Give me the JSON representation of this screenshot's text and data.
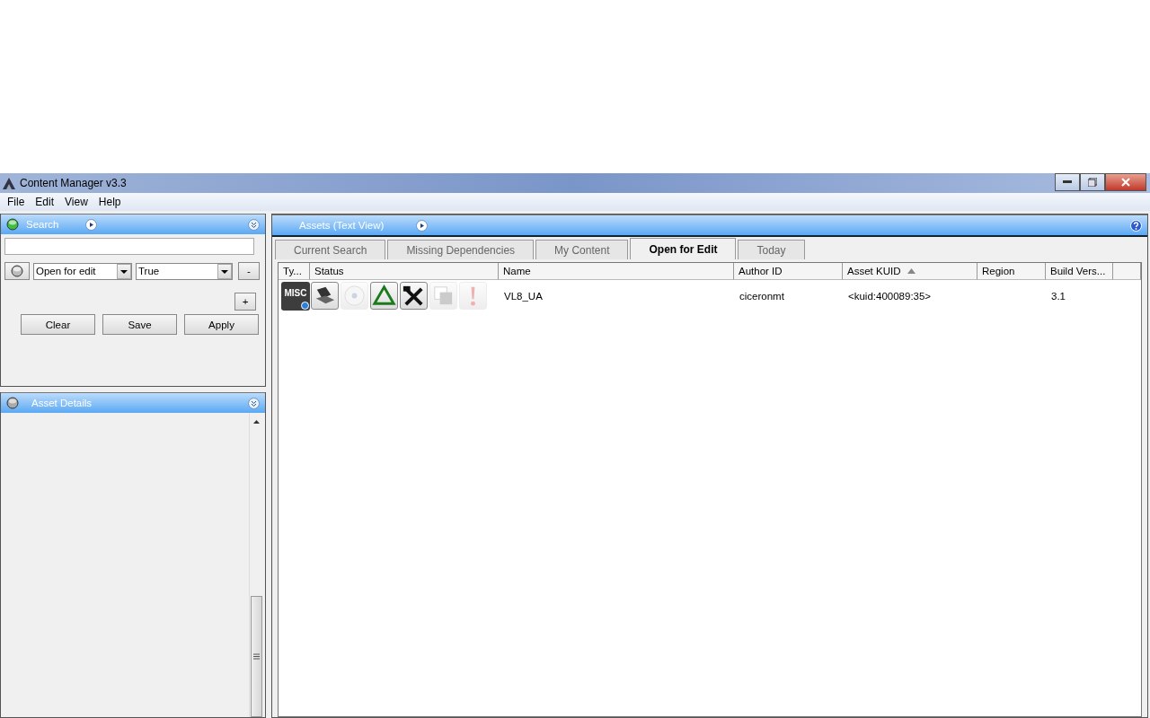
{
  "window": {
    "title": "Content Manager v3.3"
  },
  "menu": [
    "File",
    "Edit",
    "View",
    "Help"
  ],
  "search_panel": {
    "title": "Search",
    "filter": {
      "field": "Open for edit",
      "value": "True"
    },
    "remove_button": "-",
    "add_button": "+",
    "buttons": [
      "Clear",
      "Save",
      "Apply"
    ]
  },
  "details_panel": {
    "title": "Asset Details"
  },
  "assets_panel": {
    "title": "Assets (Text View)",
    "tabs": [
      {
        "label": "Current Search",
        "selected": false
      },
      {
        "label": "Missing Dependencies",
        "selected": false
      },
      {
        "label": "My Content",
        "selected": false
      },
      {
        "label": "Open for Edit",
        "selected": true
      },
      {
        "label": "Today",
        "selected": false
      }
    ],
    "columns": [
      {
        "label": "Ty...",
        "sorted": false
      },
      {
        "label": "Status",
        "sorted": false
      },
      {
        "label": "Name",
        "sorted": false
      },
      {
        "label": "Author ID",
        "sorted": false
      },
      {
        "label": "Asset KUID",
        "sorted": true
      },
      {
        "label": "Region",
        "sorted": false
      },
      {
        "label": "Build Vers...",
        "sorted": false
      }
    ],
    "rows": [
      {
        "type": "MISC",
        "status": [
          {
            "kind": "laptop",
            "enabled": true
          },
          {
            "kind": "disc",
            "enabled": false
          },
          {
            "kind": "triangle",
            "enabled": true
          },
          {
            "kind": "tools",
            "enabled": true
          },
          {
            "kind": "copy",
            "enabled": false
          },
          {
            "kind": "alert",
            "enabled": false
          }
        ],
        "name": "VL8_UA",
        "author_id": "ciceronmt",
        "kuid": "<kuid:400089:35>",
        "build": "3.1"
      }
    ]
  }
}
